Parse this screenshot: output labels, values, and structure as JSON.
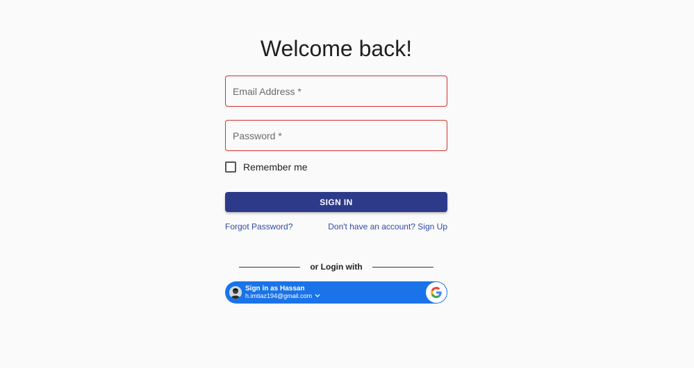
{
  "login": {
    "title": "Welcome back!",
    "email_placeholder": "Email Address *",
    "password_placeholder": "Password *",
    "remember_label": "Remember me",
    "remember_checked": false,
    "signin_label": "SIGN IN",
    "forgot_label": "Forgot Password?",
    "signup_label": "Don't have an account? Sign Up",
    "divider_label": "or Login with"
  },
  "google": {
    "name_label": "Sign in as Hassan",
    "email": "h.imtiaz194@gmail.com",
    "button_color": "#1a73e8"
  },
  "colors": {
    "accent": "#2c3a89",
    "error_border": "#d32f2f",
    "link": "#2f4aa3"
  }
}
